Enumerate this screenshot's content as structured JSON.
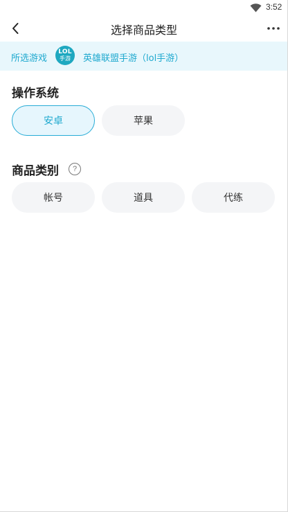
{
  "status_bar": {
    "time": "3:52",
    "wifi_icon": "wifi-icon"
  },
  "nav": {
    "title": "选择商品类型",
    "back_icon": "chevron-left-icon",
    "more_icon": "more-horizontal-icon"
  },
  "game": {
    "label": "所选游戏",
    "logo_line1": "LOL",
    "logo_line2": "手游",
    "name": "英雄联盟手游（lol手游）"
  },
  "os_section": {
    "title": "操作系统",
    "options": [
      {
        "label": "安卓",
        "selected": true
      },
      {
        "label": "苹果",
        "selected": false
      }
    ]
  },
  "category_section": {
    "title": "商品类别",
    "help_icon": "question-circle-icon",
    "help_glyph": "?",
    "options": [
      {
        "label": "帐号",
        "selected": false
      },
      {
        "label": "道具",
        "selected": false
      },
      {
        "label": "代练",
        "selected": false
      }
    ]
  },
  "colors": {
    "accent": "#1fa9cf",
    "banner_bg": "#e8f7fc",
    "chip_bg": "#f4f5f7"
  }
}
